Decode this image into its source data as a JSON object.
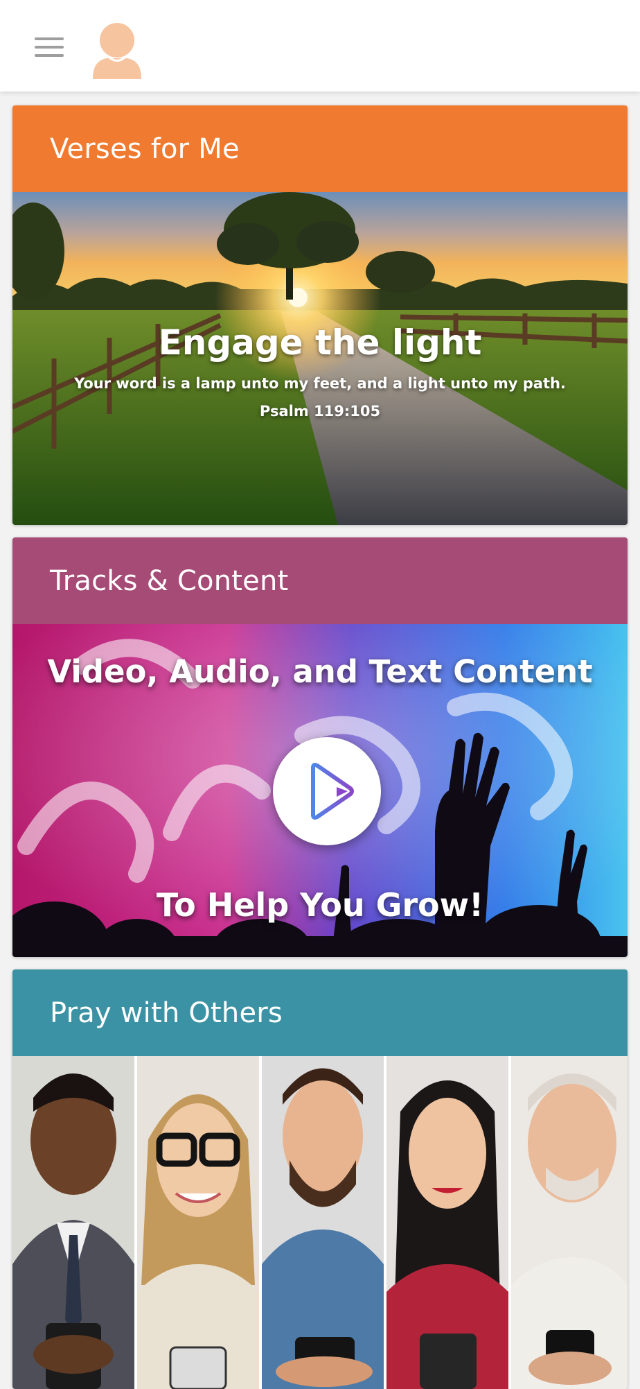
{
  "header": {
    "menu_icon": "hamburger-menu-icon",
    "avatar_icon": "user-avatar-icon"
  },
  "colors": {
    "verses_header": "#F07A30",
    "tracks_header": "#A64B75",
    "pray_header": "#3A92A4",
    "header_bg": "#FFFFFF",
    "page_bg": "#F2F2F2"
  },
  "cards": [
    {
      "title": "Verses for Me",
      "image": {
        "headline": "Engage the light",
        "verse": "Your word is a lamp unto my feet, and a light unto my path.",
        "reference": "Psalm 119:105"
      }
    },
    {
      "title": "Tracks & Content",
      "image": {
        "headline": "Video, Audio, and Text Content",
        "subline": "To Help You Grow!",
        "play_icon": "play-icon"
      }
    },
    {
      "title": "Pray with Others"
    }
  ]
}
